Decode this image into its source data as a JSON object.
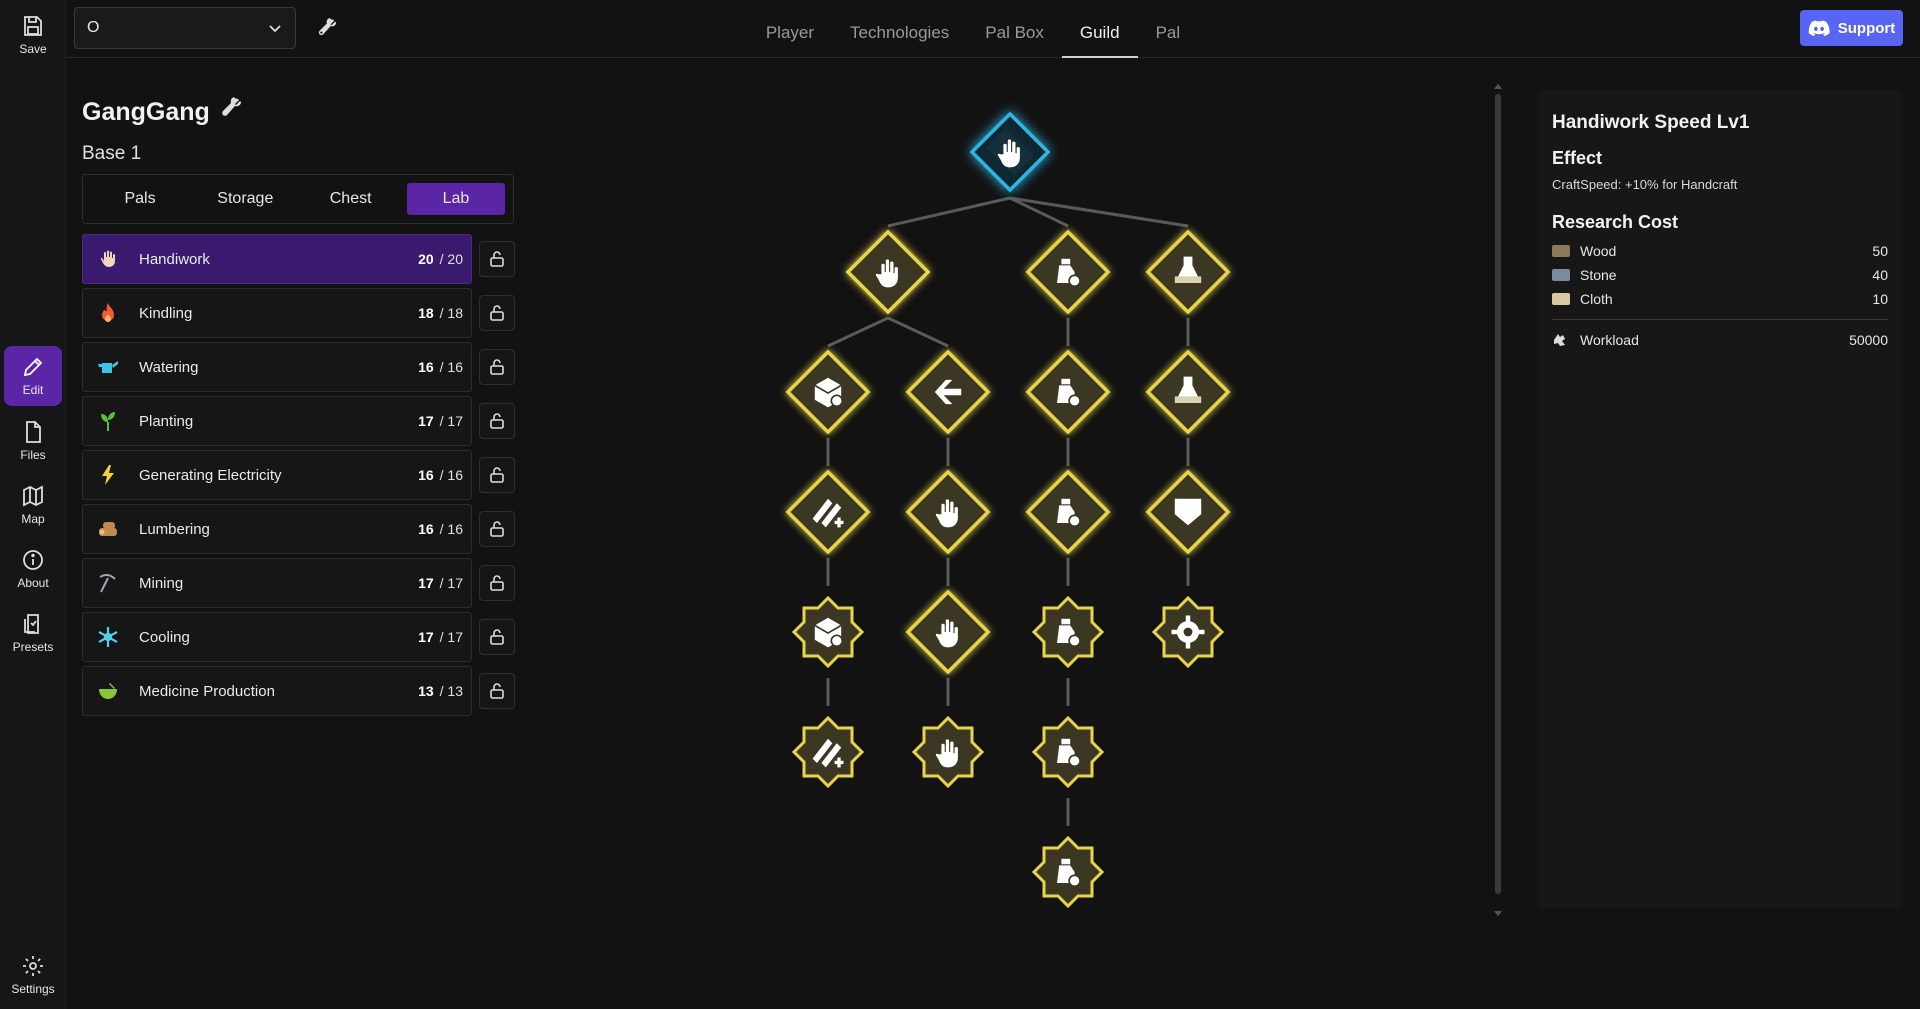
{
  "rail": {
    "save": "Save",
    "edit": "Edit",
    "files": "Files",
    "map": "Map",
    "about": "About",
    "presets": "Presets",
    "settings": "Settings"
  },
  "topbar": {
    "save_select_value": "O",
    "tabs": [
      "Player",
      "Technologies",
      "Pal Box",
      "Guild",
      "Pal"
    ],
    "active_tab": "Guild",
    "support_label": "Support"
  },
  "guild": {
    "name": "GangGang",
    "base": "Base 1",
    "subtabs": [
      "Pals",
      "Storage",
      "Chest",
      "Lab"
    ],
    "active_subtab": "Lab",
    "work": [
      {
        "label": "Handiwork",
        "count": "20",
        "max": "/ 20",
        "icon": "hand-icon",
        "color": "#f1d7b8",
        "active": true
      },
      {
        "label": "Kindling",
        "count": "18",
        "max": "/ 18",
        "icon": "fire-icon",
        "color": "#ef5a3a"
      },
      {
        "label": "Watering",
        "count": "16",
        "max": "/ 16",
        "icon": "watering-can-icon",
        "color": "#3cc6e6"
      },
      {
        "label": "Planting",
        "count": "17",
        "max": "/ 17",
        "icon": "sprout-icon",
        "color": "#5fbf3c"
      },
      {
        "label": "Generating Electricity",
        "count": "16",
        "max": "/ 16",
        "icon": "lightning-icon",
        "color": "#f4d23a"
      },
      {
        "label": "Lumbering",
        "count": "16",
        "max": "/ 16",
        "icon": "logs-icon",
        "color": "#c08a4c"
      },
      {
        "label": "Mining",
        "count": "17",
        "max": "/ 17",
        "icon": "pickaxe-icon",
        "color": "#9aa7b8"
      },
      {
        "label": "Cooling",
        "count": "17",
        "max": "/ 17",
        "icon": "snowflake-icon",
        "color": "#52d0e8"
      },
      {
        "label": "Medicine Production",
        "count": "13",
        "max": "/ 13",
        "icon": "mortar-icon",
        "color": "#8bc63a"
      }
    ]
  },
  "detail": {
    "title": "Handiwork Speed Lv1",
    "effect_heading": "Effect",
    "effect_text": "CraftSpeed: +10% for Handcraft",
    "cost_heading": "Research Cost",
    "costs": [
      {
        "name": "Wood",
        "value": "50",
        "color": "#8a7a5a"
      },
      {
        "name": "Stone",
        "value": "40",
        "color": "#7a8aa0"
      },
      {
        "name": "Cloth",
        "value": "10",
        "color": "#d8c9a0"
      }
    ],
    "workload_label": "Workload",
    "workload_value": "50000"
  },
  "colors": {
    "accent": "#5a26a6",
    "support": "#5865f2",
    "node_gold": "#e8d44a",
    "node_active": "#2fb6e0"
  }
}
